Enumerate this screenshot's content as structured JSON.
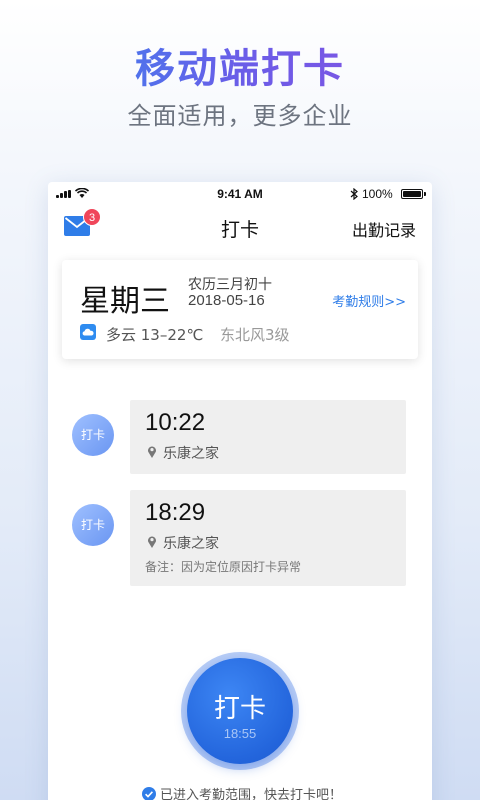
{
  "promo": {
    "title": "移动端打卡",
    "subtitle": "全面适用，更多企业"
  },
  "status_bar": {
    "time": "9:41 AM",
    "battery": "100%",
    "bluetooth_icon": "bluetooth-icon"
  },
  "nav": {
    "title": "打卡",
    "right_action": "出勤记录",
    "mail_badge": "3"
  },
  "date_card": {
    "weekday": "星期三",
    "lunar_date": "农历三月初十",
    "date": "2018-05-16",
    "rules_link": "考勤规则>>",
    "weather": "多云 13–22℃",
    "wind": "东北风3级"
  },
  "records": [
    {
      "dot_label": "打卡",
      "time": "10:22",
      "place": "乐康之家",
      "note": ""
    },
    {
      "dot_label": "打卡",
      "time": "18:29",
      "place": "乐康之家",
      "note": "备注：因为定位原因打卡异常"
    }
  ],
  "punch_button": {
    "label": "打卡",
    "time": "18:55"
  },
  "range_tip": "已进入考勤范围，快去打卡吧！",
  "colors": {
    "accent_blue": "#2365dc",
    "link_blue": "#2f7de8",
    "badge_red": "#f0465a",
    "record_bg": "#efefef"
  }
}
